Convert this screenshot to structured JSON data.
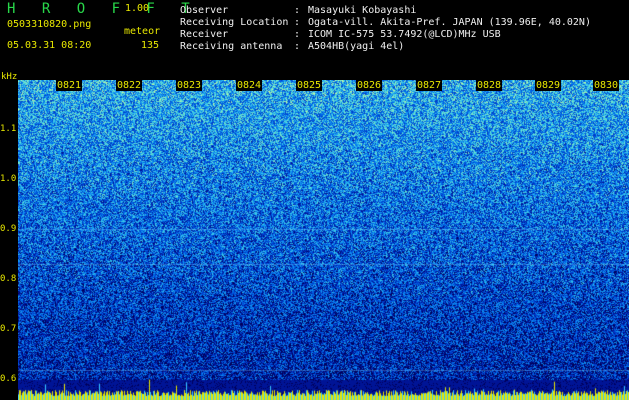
{
  "app": {
    "title": "H R O F F T",
    "version": "1.00"
  },
  "file": {
    "name": "0503310820.png",
    "datetime": "05.03.31 08:20"
  },
  "event": {
    "type": "meteor",
    "count": "135"
  },
  "station": [
    {
      "label": "Observer",
      "value": "Masayuki Kobayashi"
    },
    {
      "label": "Receiving Location",
      "value": "Ogata-vill. Akita-Pref. JAPAN (139.96E, 40.02N)"
    },
    {
      "label": "Receiver",
      "value": "ICOM IC-575 53.7492(@LCD)MHz USB"
    },
    {
      "label": "Receiving antenna",
      "value": "A504HB(yagi 4el)"
    }
  ],
  "axis": {
    "unit": "kHz",
    "freq_ticks": [
      "1.1",
      "1.0",
      "0.9",
      "0.8",
      "0.7",
      "0.6"
    ],
    "time_ticks": [
      "0821",
      "0822",
      "0823",
      "0824",
      "0825",
      "0826",
      "0827",
      "0828",
      "0829",
      "0830"
    ]
  },
  "colors": {
    "label": "#e8e800",
    "title": "#28d84a",
    "text": "#f0f0f0"
  }
}
